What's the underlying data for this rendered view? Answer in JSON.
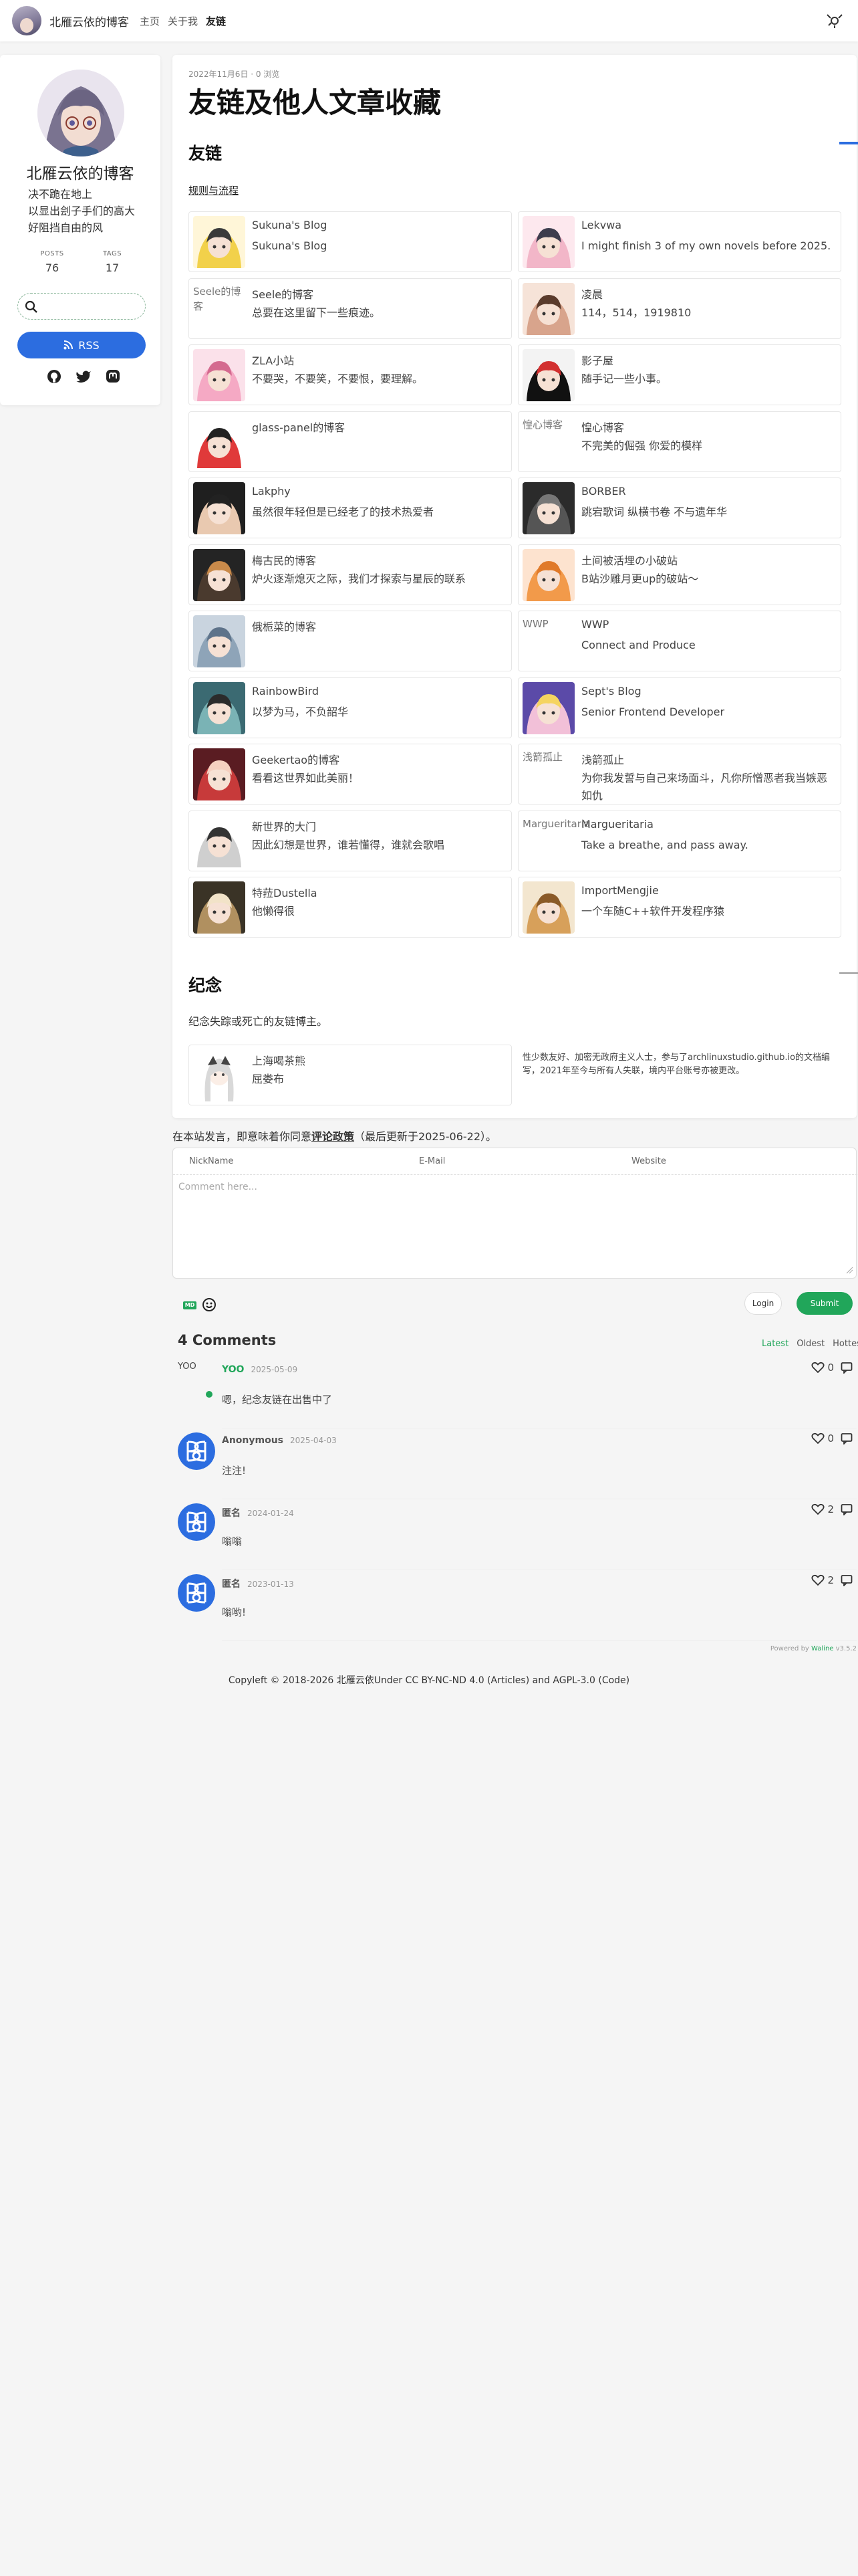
{
  "header": {
    "site_title": "北雁云依的博客",
    "nav": [
      {
        "label": "主页"
      },
      {
        "label": "关于我"
      },
      {
        "label": "友链"
      }
    ]
  },
  "sidebar": {
    "name": "北雁云依的博客",
    "bio": [
      "决不跪在地上",
      "以显出刽子手们的高大",
      "好阻挡自由的风"
    ],
    "stats": [
      {
        "label": "POSTS",
        "value": "76"
      },
      {
        "label": "TAGS",
        "value": "17"
      }
    ],
    "rss_label": "RSS"
  },
  "article": {
    "date": "2022年11月6日",
    "views": "0 浏览",
    "title": "友链及他人文章收藏",
    "friends_heading": "友链",
    "rules_link": "规则与流程",
    "friends": [
      {
        "name": "Sukuna's Blog",
        "desc": "Sukuna's Blog"
      },
      {
        "name": "Lekvwa",
        "desc": "I might finish 3 of my own novels before 2025."
      },
      {
        "name": "Seele的博客",
        "desc": "总要在这里留下一些痕迹。",
        "img_alt": "Seele的博客"
      },
      {
        "name": "凌晨",
        "desc": "114，514，1919810"
      },
      {
        "name": "ZLA小站",
        "desc": "不要哭，不要笑，不要恨，要理解。"
      },
      {
        "name": "影子屋",
        "desc": "随手记一些小事。"
      },
      {
        "name": "glass-panel的博客",
        "desc": ""
      },
      {
        "name": "惶心博客",
        "desc": "不完美的倔强 你爱的模样",
        "img_alt": "惶心博客"
      },
      {
        "name": "Lakphy",
        "desc": "虽然很年轻但是已经老了的技术热爱者"
      },
      {
        "name": "BORBER",
        "desc": "跳宕歌词 纵横书卷 不与遗年华"
      },
      {
        "name": "梅古民的博客",
        "desc": "炉火逐渐熄灭之际，我们才探索与星辰的联系"
      },
      {
        "name": "土间被活埋の小破站",
        "desc": "B站沙雕月更up的破站～"
      },
      {
        "name": "俄栀菜的博客",
        "desc": ""
      },
      {
        "name": "WWP",
        "desc": "Connect and Produce",
        "img_alt": "WWP"
      },
      {
        "name": "RainbowBird",
        "desc": "以梦为马，不负韶华"
      },
      {
        "name": "Sept's Blog",
        "desc": "Senior Frontend Developer"
      },
      {
        "name": "Geekertao的博客",
        "desc": "看看这世界如此美丽！"
      },
      {
        "name": "浅箭孤止",
        "desc": "为你我发誓与自己来场面斗，凡你所憎恶者我当嫉恶如仇",
        "img_alt": "浅箭孤止"
      },
      {
        "name": "新世界的大门",
        "desc": "因此幻想是世界，谁若懂得，谁就会歌唱"
      },
      {
        "name": "Margueritaria",
        "desc": "Take a breathe, and pass away.",
        "img_alt": "Margueritaria"
      },
      {
        "name": "特菈Dustella",
        "desc": "他懒得很"
      },
      {
        "name": "ImportMengjie",
        "desc": "一个车随C++软件开发程序猿"
      }
    ],
    "memorial_heading": "纪念",
    "memorial_intro": "纪念失踪或死亡的友链博主。",
    "memorial": [
      {
        "name": "上海喝茶熊",
        "desc": "屈娄布"
      }
    ],
    "memorial_note": "性少数友好、加密无政府主义人士，参与了archlinuxstudio.github.io的文档编写，2021年至今与所有人失联，境内平台账号亦被更改。"
  },
  "comments": {
    "notice_pre": "在本站发言，即意味着你同意",
    "notice_link": "评论政策",
    "notice_post": "（最后更新于2025-06-22）。",
    "fields": [
      "NickName",
      "E-Mail",
      "Website"
    ],
    "placeholder": "Comment here...",
    "md_badge": "MD",
    "login": "Login",
    "submit": "Submit",
    "count_text": "4 Comments",
    "sorts": [
      "Latest",
      "Oldest",
      "Hottest"
    ],
    "items": [
      {
        "nick": "YOO",
        "date": "2025-05-09",
        "text": "嗯，纪念友链在出售中了",
        "likes": "0",
        "avatar_alt": "YOO"
      },
      {
        "nick": "Anonymous",
        "date": "2025-04-03",
        "text": "注注!",
        "likes": "0"
      },
      {
        "nick": "匿名",
        "date": "2024-01-24",
        "text": "嗡嗡",
        "likes": "2"
      },
      {
        "nick": "匿名",
        "date": "2023-01-13",
        "text": "嗡哟!",
        "likes": "2"
      }
    ],
    "powered_pre": "Powered by ",
    "powered_name": "Waline",
    "powered_ver": " v3.5.2"
  },
  "footer": {
    "text": "Copyleft © 2018-2026 北雁云依Under CC BY-NC-ND 4.0 (Articles) and AGPL-3.0 (Code)"
  },
  "colors": {
    "accent_blue": "#2c6de0",
    "accent_green": "#21a65a"
  }
}
